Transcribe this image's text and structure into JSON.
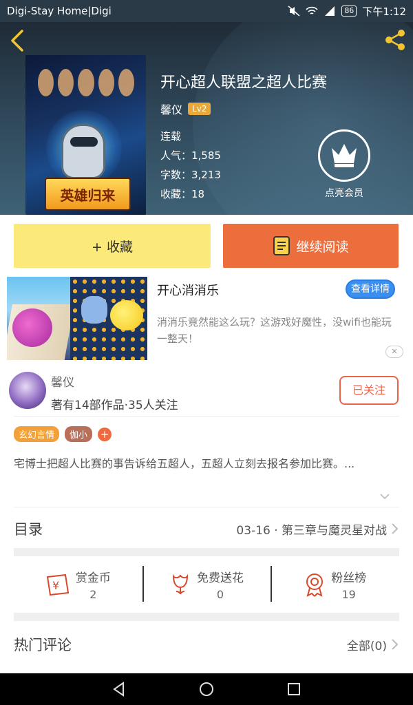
{
  "status_bar": {
    "app_label": "Digi-Stay Home|Digi",
    "battery": "86",
    "time": "下午1:12"
  },
  "book": {
    "title": "开心超人联盟之超人比赛",
    "author": "馨仪",
    "level": "Lv2",
    "status": "连载",
    "popularity": "人气：1,585",
    "word_count": "字数：3,213",
    "favorites": "收藏：18",
    "cover_text": "英雄归来",
    "vip_label": "点亮会员"
  },
  "actions": {
    "collect": "+ 收藏",
    "read": "继续阅读"
  },
  "ad": {
    "title": "开心消消乐",
    "detail_button": "查看详情",
    "description": "消消乐竟然能这么玩？这游戏好魔性，没wifi也能玩一整天！"
  },
  "author_card": {
    "name": "馨仪",
    "info": "著有14部作品·35人关注",
    "follow_state": "已关注"
  },
  "tags": [
    "玄幻言情",
    "伽小"
  ],
  "synopsis": "宅博士把超人比赛的事告诉给五超人，五超人立刻去报名参加比赛。...",
  "toc": {
    "label": "目录",
    "latest": "03-16 · 第三章与魔灵星对战"
  },
  "rewards": [
    {
      "label": "赏金币",
      "value": "2",
      "icon": "coin-icon"
    },
    {
      "label": "免费送花",
      "value": "0",
      "icon": "flower-icon"
    },
    {
      "label": "粉丝榜",
      "value": "19",
      "icon": "medal-icon"
    }
  ],
  "comments": {
    "label": "热门评论",
    "all": "全部(0)"
  },
  "colors": {
    "accent_orange": "#ec6e3d",
    "collect_yellow": "#fbe97a",
    "level_badge": "#e8a93a",
    "follow_red": "#e8654a"
  }
}
